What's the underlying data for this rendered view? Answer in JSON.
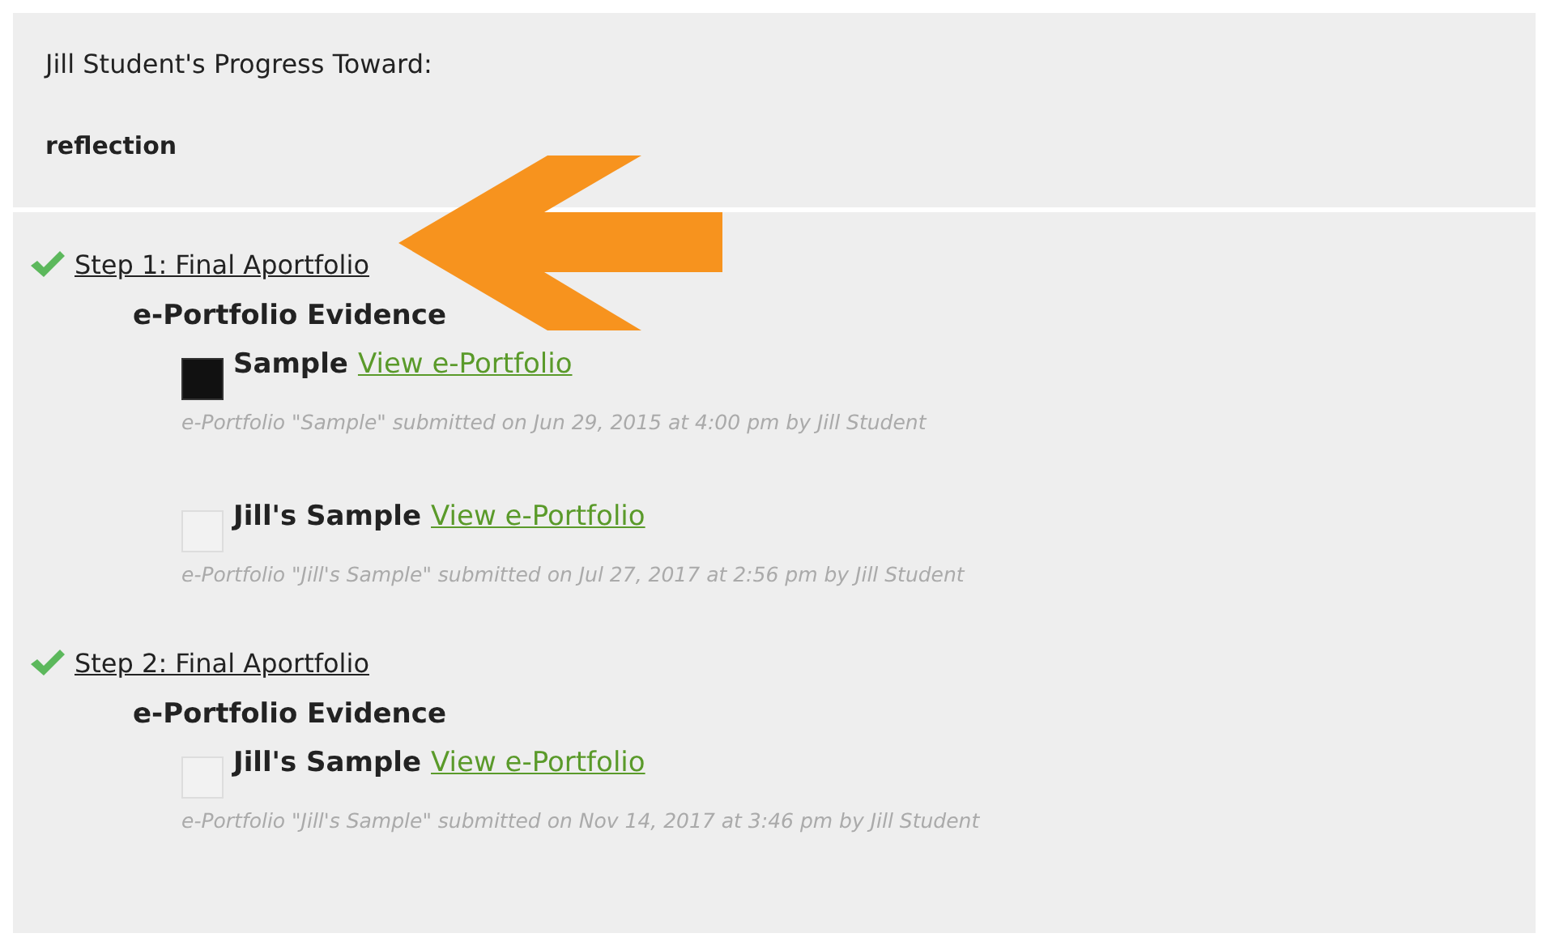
{
  "header": {
    "title": "Jill Student's Progress Toward:",
    "subtitle": "reflection"
  },
  "steps": [
    {
      "label": "Step 1: Final Aportfolio",
      "completed": true,
      "pointer": true,
      "evidence_heading": "e-Portfolio Evidence",
      "items": [
        {
          "name": "Sample",
          "link": "View e-Portfolio",
          "kind": "dark",
          "caption": "e-Portfolio \"Sample\" submitted on Jun 29, 2015 at 4:00 pm by Jill Student"
        },
        {
          "name": "Jill's Sample",
          "link": "View e-Portfolio",
          "kind": "blank",
          "caption": "e-Portfolio \"Jill's Sample\" submitted on Jul 27, 2017 at 2:56 pm by Jill Student"
        }
      ]
    },
    {
      "label": "Step 2: Final Aportfolio",
      "completed": true,
      "pointer": false,
      "evidence_heading": "e-Portfolio Evidence",
      "items": [
        {
          "name": "Jill's Sample",
          "link": "View e-Portfolio",
          "kind": "blank",
          "caption": "e-Portfolio \"Jill's Sample\" submitted on Nov 14, 2017 at 3:46 pm by Jill Student"
        }
      ]
    }
  ]
}
